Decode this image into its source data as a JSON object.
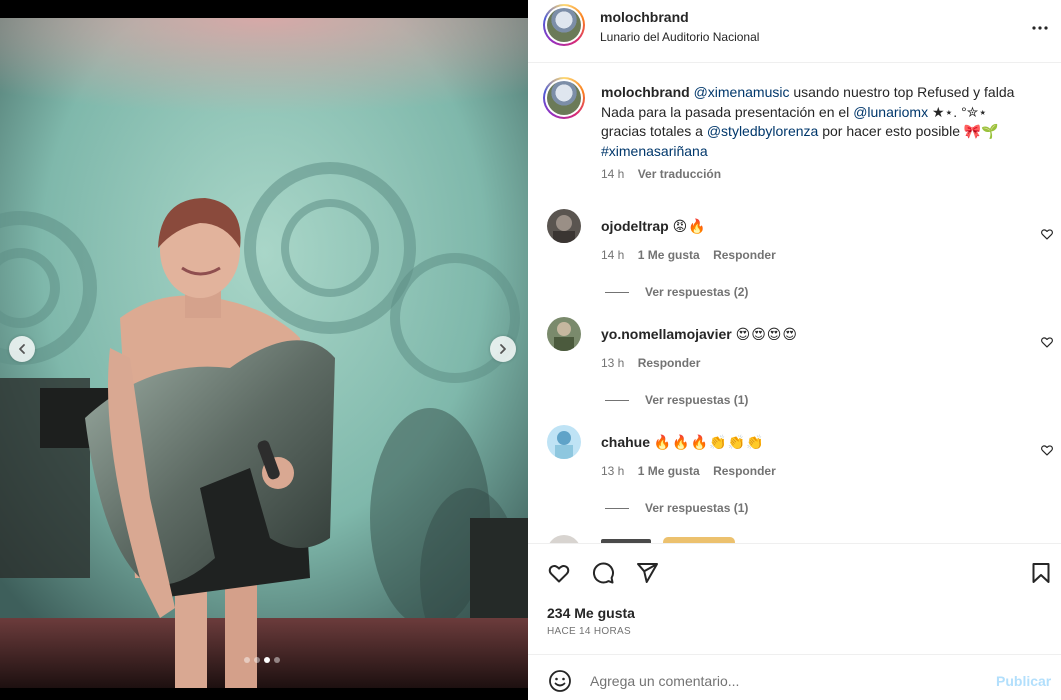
{
  "post": {
    "username": "molochbrand",
    "location": "Lunario del Auditorio Nacional",
    "menu_icon": "more-horizontal-icon"
  },
  "caption": {
    "username": "molochbrand",
    "mention1": "@ximenamusic",
    "text1": " usando nuestro top Refused y falda Nada para la pasada presentación en el ",
    "mention2": "@lunariomx",
    "text2": " ★⋆. °✮⋆ gracias totales a ",
    "mention3": "@styledbylorenza",
    "text3": " por hacer esto posible 🎀🌱 ",
    "hashtag": "#ximenasariñana",
    "time": "14 h",
    "translate": "Ver traducción"
  },
  "comments": [
    {
      "username": "ojodeltrap",
      "text": "😡🔥",
      "time": "14 h",
      "likes": "1 Me gusta",
      "reply": "Responder",
      "view_replies": "Ver respuestas (2)"
    },
    {
      "username": "yo.nomellamojavier",
      "text": "😍😍😍😍",
      "time": "13 h",
      "likes": "",
      "reply": "Responder",
      "view_replies": "Ver respuestas (1)"
    },
    {
      "username": "chahue",
      "text": "🔥🔥🔥👏👏👏",
      "time": "13 h",
      "likes": "1 Me gusta",
      "reply": "Responder",
      "view_replies": "Ver respuestas (1)"
    }
  ],
  "actions": {
    "like_icon": "heart-icon",
    "comment_icon": "comment-icon",
    "share_icon": "send-icon",
    "save_icon": "bookmark-icon"
  },
  "likes_count": "234 Me gusta",
  "time_ago": "HACE 14 HORAS",
  "add_comment": {
    "placeholder": "Agrega un comentario...",
    "publish": "Publicar",
    "emoji_icon": "smiley-icon"
  },
  "carousel": {
    "current": 3,
    "total": 4
  },
  "colors": {
    "link": "#00376b",
    "muted": "#737373",
    "publish_disabled": "#b2dffc"
  }
}
